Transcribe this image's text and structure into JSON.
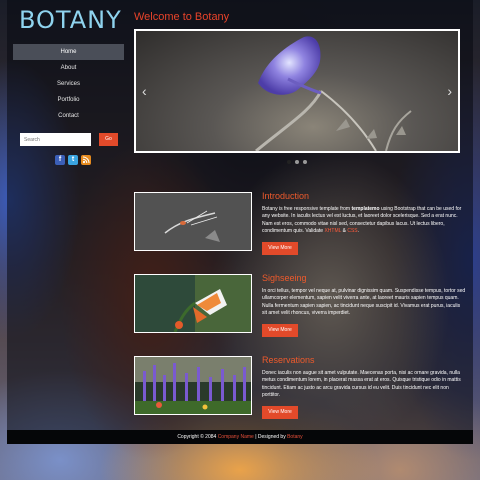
{
  "logo": "BOTANY",
  "nav": [
    {
      "label": "Home",
      "active": true
    },
    {
      "label": "About"
    },
    {
      "label": "Services"
    },
    {
      "label": "Portfolio"
    },
    {
      "label": "Contact"
    }
  ],
  "search": {
    "placeholder": "Search",
    "button": "Go"
  },
  "social": [
    "facebook-icon",
    "twitter-icon",
    "rss-icon"
  ],
  "welcome": "Welcome to Botany",
  "slider": {
    "prev": "‹",
    "next": "›",
    "dots": 3,
    "active_dot": 0
  },
  "cards": [
    {
      "title": "Introduction",
      "text_before": "Botany is free responsive template from ",
      "text_bold": "templatemo",
      "text_after": " using Bootstrap that can be used for any website. In iaculis lectus vel est luctus, et laoreet dolor scelerisque. Sed a erat nunc. Nam est eros, commodo vitae nisl sed, consectetur dapibus lacus. Ut lectus libero, condimentum quis. Validate ",
      "link1": "XHTML",
      "amp": " & ",
      "link2": "CSS",
      "end": ".",
      "button": "View More"
    },
    {
      "title": "Sighseeing",
      "text": "In orci tellus, tempor vel neque at, pulvinar dignissim quam. Suspendisse tempus, tortor sed ullamcorper elementum, sapien velit viverra ante, at laoreet mauris sapien tempus quam. Nulla fermentum sapien sapien, ac tincidunt neque suscipit id. Vivamus erat purus, iaculis sit amet velit rhoncus, viverra imperdiet.",
      "button": "View More"
    },
    {
      "title": "Reservations",
      "text": "Donec iaculis non augue sit amet vulputate. Maecenas porta, nisi ac ornare gravida, nulla metus condimentum lorem, in placerat massa erat at eros. Quisque tristique odio in mattis tincidunt. Etiam ac justo ac arcu gravida cursus id eu velit. Duis tincidunt nec elit non porttitor.",
      "button": "View More"
    }
  ],
  "footer": {
    "copyright": "Copyright © 2084 ",
    "company": "Company Name",
    "designed": " | Designed by ",
    "designer": "Botany"
  },
  "colors": {
    "accent": "#e24a2a",
    "logo": "#8fd3ee",
    "title": "#e8432a"
  }
}
